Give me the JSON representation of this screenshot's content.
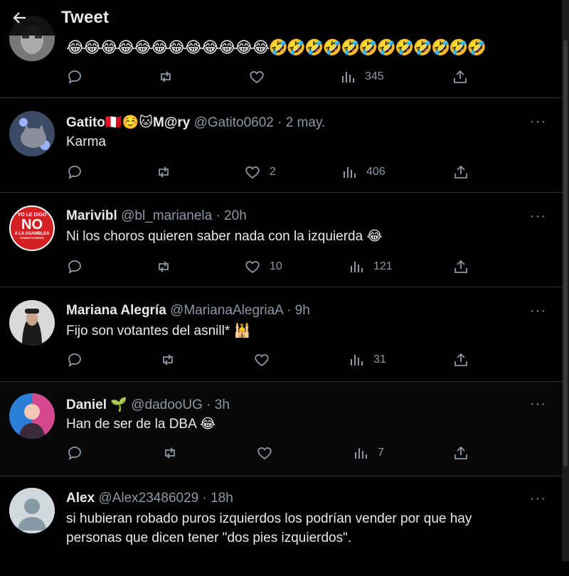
{
  "header": {
    "title": "Tweet"
  },
  "first_tweet": {
    "emojis": "😂😂😂😂😂😂😂😂😂😂😂😂🤣🤣🤣🤣🤣🤣🤣🤣🤣🤣🤣🤣",
    "views": "345"
  },
  "replies": [
    {
      "display_name": "Gatito🇵🇪☺️🐱M@ry",
      "handle": "@Gatito0602",
      "time": "· 2 may.",
      "text": "Karma",
      "retweets": "",
      "likes": "2",
      "views": "406"
    },
    {
      "display_name": "Marivibl",
      "handle": "@bl_marianela",
      "time": "· 20h",
      "text": "Ni los choros quieren saber nada con la izquierda 😂",
      "retweets": "",
      "likes": "10",
      "views": "121",
      "avatar_text": [
        "YO LE DIGO",
        "NO",
        "A LA ASAMBLEA",
        "CONSTITUYENTE"
      ]
    },
    {
      "display_name": "Mariana Alegría",
      "handle": "@MarianaAlegriaA",
      "time": "· 9h",
      "text": "Fijo son votantes del asnill* 🕌",
      "retweets": "",
      "likes": "",
      "views": "31"
    },
    {
      "display_name": "Daniel 🌱",
      "handle": "@dadooUG",
      "time": "· 3h",
      "text": "Han de ser de la DBA 😂",
      "retweets": "",
      "likes": "",
      "views": "7"
    },
    {
      "display_name": "Alex",
      "handle": "@Alex23486029",
      "time": "· 18h",
      "text": "si hubieran robado puros izquierdos los podrían vender por que hay personas que dicen tener \"dos pies izquierdos\".",
      "retweets": "",
      "likes": "",
      "views": ""
    }
  ],
  "more_label": "···",
  "colors": {
    "background": "#000000",
    "text": "#e7e9ea",
    "secondary": "#8b98a5",
    "border": "#2f3336"
  }
}
